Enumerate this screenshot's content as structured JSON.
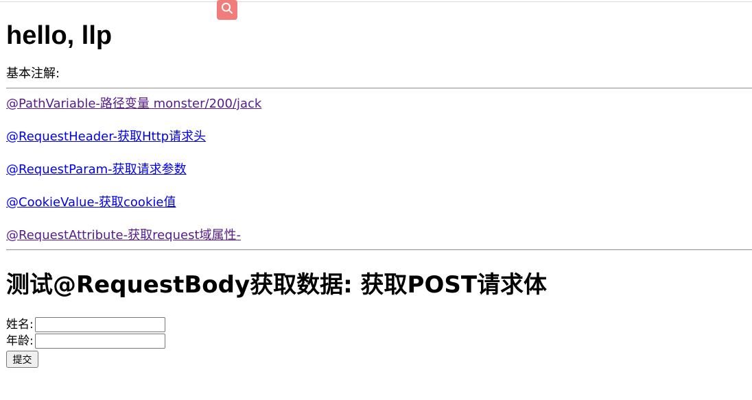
{
  "page": {
    "title": "hello, llp",
    "intro": "基本注解:"
  },
  "links": [
    {
      "label": "@PathVariable-路径变量 monster/200/jack",
      "visited": true
    },
    {
      "label": "@RequestHeader-获取Http请求头",
      "visited": false
    },
    {
      "label": "@RequestParam-获取请求参数",
      "visited": false
    },
    {
      "label": "@CookieValue-获取cookie值",
      "visited": false
    },
    {
      "label": "@RequestAttribute-获取request域属性-",
      "visited": true
    }
  ],
  "form": {
    "heading": "测试@RequestBody获取数据: 获取POST请求体",
    "name_label": "姓名:",
    "name_value": "",
    "age_label": "年龄:",
    "age_value": "",
    "submit_label": "提交"
  },
  "colors": {
    "search_badge": "#f07c7c",
    "link_unvisited": "#0000ee",
    "link_visited": "#551a8b"
  },
  "icons": {
    "search": "search-icon"
  }
}
